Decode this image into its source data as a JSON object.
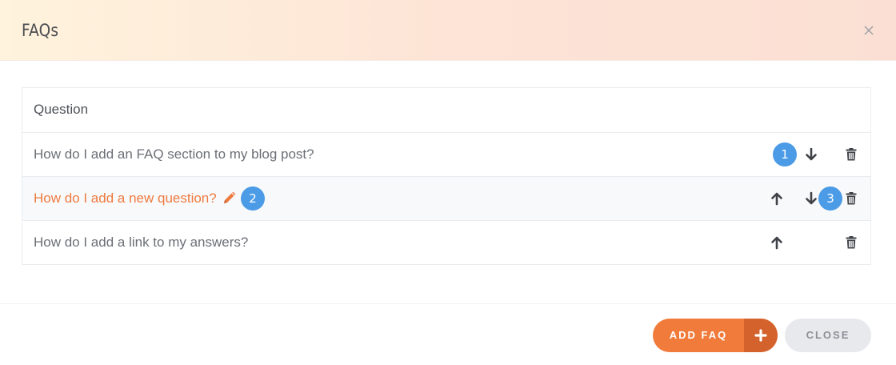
{
  "header": {
    "title": "FAQs",
    "close_icon": "close-icon"
  },
  "table": {
    "column_header": "Question",
    "rows": [
      {
        "question": "How do I add an FAQ section to my blog post?",
        "active": false,
        "controls": [
          "arrow-down-icon",
          "trash-icon"
        ]
      },
      {
        "question": "How do I add a new question?",
        "active": true,
        "controls": [
          "pencil-icon",
          "arrow-up-icon",
          "arrow-down-icon",
          "trash-icon"
        ]
      },
      {
        "question": "How do I add a link to my answers?",
        "active": false,
        "controls": [
          "arrow-up-icon",
          "trash-icon"
        ]
      }
    ]
  },
  "badges": [
    "1",
    "2",
    "3"
  ],
  "footer": {
    "add_label": "ADD FAQ",
    "add_icon": "plus-icon",
    "close_label": "CLOSE"
  },
  "colors": {
    "accent": "#f07b3a",
    "accent_dark": "#d4622c",
    "badge": "#4b9be6",
    "active_text": "#ee7a3f"
  }
}
